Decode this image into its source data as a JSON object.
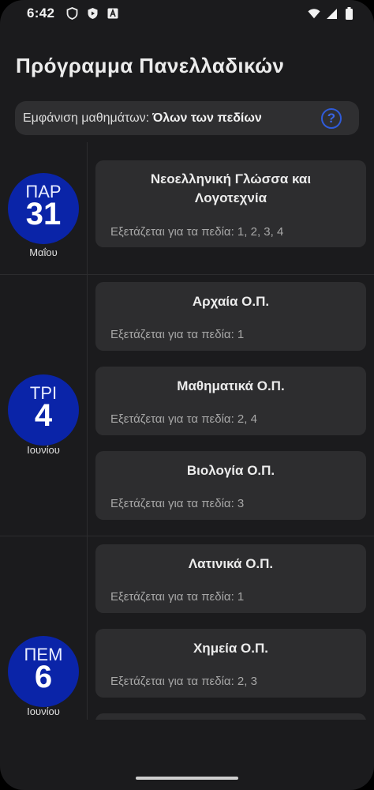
{
  "status_bar": {
    "time": "6:42",
    "left_icons": [
      "shield-outline-icon",
      "shield-play-icon",
      "letter-a-icon"
    ],
    "right_icons": [
      "wifi-icon",
      "signal-icon",
      "battery-icon"
    ]
  },
  "header": {
    "title": "Πρόγραμμα Πανελλαδικών"
  },
  "filter": {
    "label": "Εμφάνιση μαθημάτων:",
    "value": "Όλων των πεδίων",
    "help_glyph": "?"
  },
  "days": [
    {
      "weekday": "ΠΑΡ",
      "day": "31",
      "month": "Μαΐου",
      "exams": [
        {
          "title_line1": "Νεοελληνική Γλώσσα και",
          "title_line2": "Λογοτεχνία",
          "fields": "Εξετάζεται για τα πεδία: 1, 2, 3, 4"
        }
      ]
    },
    {
      "weekday": "ΤΡΙ",
      "day": "4",
      "month": "Ιουνίου",
      "exams": [
        {
          "title": "Αρχαία Ο.Π.",
          "fields": "Εξετάζεται για τα πεδία: 1"
        },
        {
          "title": "Μαθηματικά Ο.Π.",
          "fields": "Εξετάζεται για τα πεδία: 2, 4"
        },
        {
          "title": "Βιολογία Ο.Π.",
          "fields": "Εξετάζεται για τα πεδία: 3"
        }
      ]
    },
    {
      "weekday": "ΠΕΜ",
      "day": "6",
      "month": "Ιουνίου",
      "exams": [
        {
          "title": "Λατινικά Ο.Π.",
          "fields": "Εξετάζεται για τα πεδία: 1"
        },
        {
          "title": "Χημεία Ο.Π.",
          "fields": "Εξετάζεται για τα πεδία: 2, 3"
        }
      ]
    }
  ],
  "colors": {
    "background": "#1b1b1d",
    "card": "#2d2d2f",
    "date_badge": "#0a24a8",
    "help_accent": "#2f5bd9"
  }
}
